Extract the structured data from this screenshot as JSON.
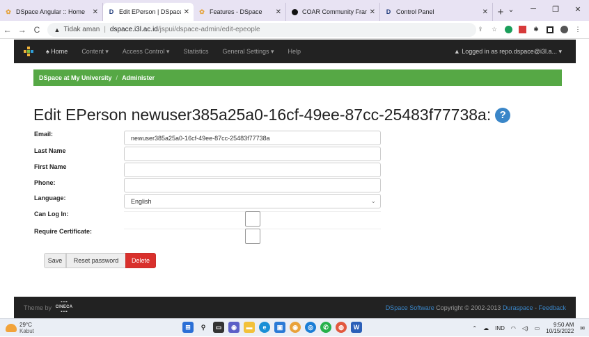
{
  "browser": {
    "tabs": [
      {
        "label": "DSpace Angular :: Home",
        "icon": "dspace-logo-icon"
      },
      {
        "label": "Edit EPerson | DSpace at M",
        "icon": "dspace-d-icon",
        "active": true
      },
      {
        "label": "Features - DSpace",
        "icon": "dspace-logo-icon"
      },
      {
        "label": "COAR Community Framew",
        "icon": "coar-icon"
      },
      {
        "label": "Control Panel",
        "icon": "dspace-d-icon"
      }
    ],
    "address": {
      "security_label": "Tidak aman",
      "host": "dspace.i3l.ac.id",
      "path": "/jspui/dspace-admin/edit-epeople"
    }
  },
  "navbar": {
    "items": [
      "Home",
      "Content",
      "Access Control",
      "Statistics",
      "General Settings",
      "Help"
    ],
    "login_label": "Logged in as repo.dspace@i3l.a..."
  },
  "breadcrumb": {
    "root": "DSpace at My University",
    "current": "Administer"
  },
  "page": {
    "title": "Edit EPerson newuser385a25a0-16cf-49ee-87cc-25483f77738a:"
  },
  "form": {
    "email_label": "Email:",
    "email_value": "newuser385a25a0-16cf-49ee-87cc-25483f77738a",
    "lastname_label": "Last Name",
    "lastname_value": "",
    "firstname_label": "First Name",
    "firstname_value": "",
    "phone_label": "Phone:",
    "phone_value": "",
    "language_label": "Language:",
    "language_value": "English",
    "canlogin_label": "Can Log In:",
    "canlogin_checked": false,
    "reqcert_label": "Require Certificate:",
    "reqcert_checked": false
  },
  "buttons": {
    "save": "Save",
    "reset": "Reset password",
    "delete": "Delete"
  },
  "footer": {
    "theme_label": "Theme by",
    "cineca_line1": "CINECA",
    "copyright_link": "DSpace Software",
    "copyright_text": " Copyright © 2002-2013 ",
    "duraspace": "Duraspace",
    "dash": " - ",
    "feedback": "Feedback"
  },
  "taskbar": {
    "temperature": "29°C",
    "condition": "Kabut",
    "lang": "IND",
    "time": "9:50 AM",
    "date": "10/15/2022"
  },
  "colors": {
    "navbar": "#222222",
    "breadcrumb": "#56a845",
    "delete": "#d9302c",
    "help": "#3a86c8"
  }
}
